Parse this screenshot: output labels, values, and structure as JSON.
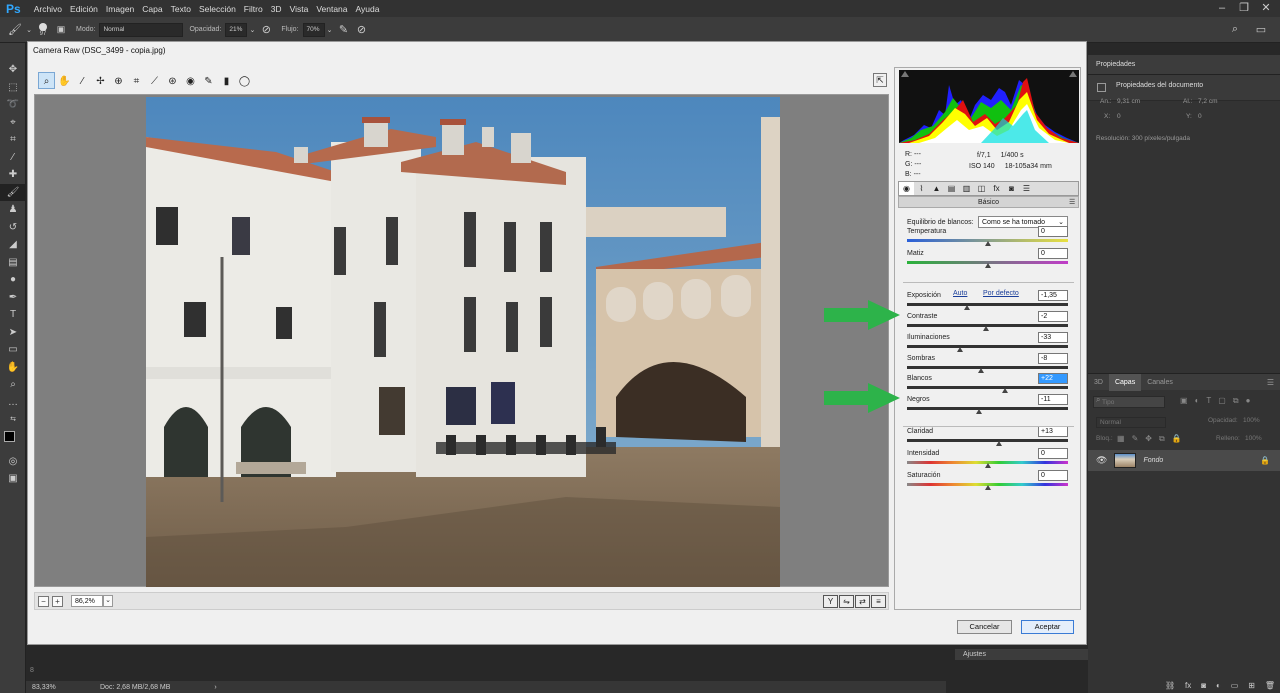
{
  "app": {
    "logo": "Ps",
    "menu": [
      "Archivo",
      "Edición",
      "Imagen",
      "Capa",
      "Texto",
      "Selección",
      "Filtro",
      "3D",
      "Vista",
      "Ventana",
      "Ayuda"
    ]
  },
  "options_bar": {
    "brush_size": "97",
    "mode_label": "Modo:",
    "mode_value": "Normal",
    "opacity_label": "Opacidad:",
    "opacity_value": "21%",
    "flow_label": "Flujo:",
    "flow_value": "70%"
  },
  "status": {
    "zoom": "83,33%",
    "doc": "Doc: 2,68 MB/2,68 MB",
    "ruler_num": "8"
  },
  "properties_panel": {
    "tab": "Propiedades",
    "section": "Propiedades del documento",
    "width_label": "An.:",
    "width_value": "9,31 cm",
    "height_label": "Al.:",
    "height_value": "7,2 cm",
    "x_label": "X:",
    "x_value": "0",
    "y_label": "Y:",
    "y_value": "0",
    "resolution": "Resolución: 300 píxeles/pulgada"
  },
  "layers_panel": {
    "tabs": [
      "3D",
      "Capas",
      "Canales"
    ],
    "search_placeholder": "Tipo",
    "blend_mode": "Normal",
    "opacity_label": "Opacidad:",
    "opacity_value": "100%",
    "lock_label": "Bloq.:",
    "fill_label": "Relleno:",
    "fill_value": "100%",
    "layer_name": "Fondo",
    "ajustes": "Ajustes"
  },
  "camera_raw": {
    "title": "Camera Raw (DSC_3499 - copia.jpg)",
    "zoom_value": "86,2%",
    "rgb": {
      "r_label": "R:",
      "r": "---",
      "g_label": "G:",
      "g": "---",
      "b_label": "B:",
      "b": "---"
    },
    "meta": {
      "aperture": "f/7,1",
      "shutter": "1/400 s",
      "iso": "ISO 140",
      "lens": "18-105a34 mm"
    },
    "panel_title": "Básico",
    "wb_label": "Equilibrio de blancos:",
    "wb_value": "Como se ha tomado",
    "auto": "Auto",
    "defaults": "Por defecto",
    "sliders": [
      {
        "label": "Temperatura",
        "value": "0",
        "pos": 0.5
      },
      {
        "label": "Matiz",
        "value": "0",
        "pos": 0.5
      },
      {
        "label": "Exposición",
        "value": "-1,35",
        "pos": 0.37
      },
      {
        "label": "Contraste",
        "value": "-2",
        "pos": 0.49
      },
      {
        "label": "Iluminaciones",
        "value": "-33",
        "pos": 0.33
      },
      {
        "label": "Sombras",
        "value": "-8",
        "pos": 0.46
      },
      {
        "label": "Blancos",
        "value": "+22",
        "pos": 0.61
      },
      {
        "label": "Negros",
        "value": "-11",
        "pos": 0.45
      },
      {
        "label": "Claridad",
        "value": "+13",
        "pos": 0.57
      },
      {
        "label": "Intensidad",
        "value": "0",
        "pos": 0.5
      },
      {
        "label": "Saturación",
        "value": "0",
        "pos": 0.5
      }
    ],
    "cancel": "Cancelar",
    "accept": "Aceptar"
  },
  "colors": {
    "accent": "#31a8ff",
    "arrow_green": "#2db34a",
    "highlight": "#3399ff"
  }
}
